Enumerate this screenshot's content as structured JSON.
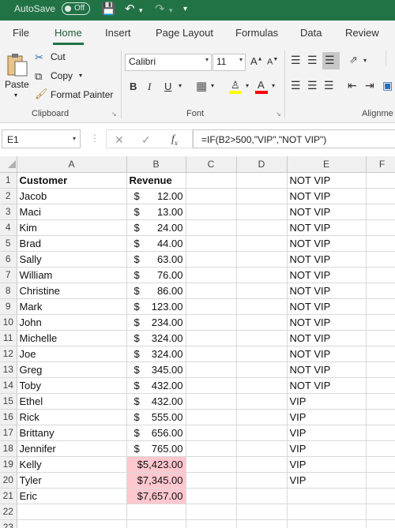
{
  "titlebar": {
    "autosave_label": "AutoSave",
    "autosave_state": "Off"
  },
  "ribbon_tabs": [
    "File",
    "Home",
    "Insert",
    "Page Layout",
    "Formulas",
    "Data",
    "Review"
  ],
  "active_tab": "Home",
  "clipboard": {
    "paste": "Paste",
    "cut": "Cut",
    "copy": "Copy",
    "format_painter": "Format Painter",
    "label": "Clipboard"
  },
  "font": {
    "name": "Calibri",
    "size": "11",
    "label": "Font",
    "bold": "B",
    "italic": "I",
    "underline": "U",
    "fill_color": "#ffff00",
    "text_color": "#ff0000"
  },
  "alignment": {
    "label": "Alignme"
  },
  "formula_bar": {
    "name_box": "E1",
    "formula": "=IF(B2>500,\"VIP\",\"NOT VIP\")"
  },
  "columns": [
    "A",
    "B",
    "C",
    "D",
    "E",
    "F"
  ],
  "active_column": "E",
  "headers": {
    "a": "Customer",
    "b": "Revenue"
  },
  "rows": [
    {
      "n": "1",
      "a": "Customer",
      "b": "Revenue",
      "e": "NOT VIP"
    },
    {
      "n": "2",
      "a": "Jacob",
      "b": "12.00",
      "e": "NOT VIP"
    },
    {
      "n": "3",
      "a": "Maci",
      "b": "13.00",
      "e": "NOT VIP"
    },
    {
      "n": "4",
      "a": "Kim",
      "b": "24.00",
      "e": "NOT VIP"
    },
    {
      "n": "5",
      "a": "Brad",
      "b": "44.00",
      "e": "NOT VIP"
    },
    {
      "n": "6",
      "a": "Sally",
      "b": "63.00",
      "e": "NOT VIP"
    },
    {
      "n": "7",
      "a": "William",
      "b": "76.00",
      "e": "NOT VIP"
    },
    {
      "n": "8",
      "a": "Christine",
      "b": "86.00",
      "e": "NOT VIP"
    },
    {
      "n": "9",
      "a": "Mark",
      "b": "123.00",
      "e": "NOT VIP"
    },
    {
      "n": "10",
      "a": "John",
      "b": "234.00",
      "e": "NOT VIP"
    },
    {
      "n": "11",
      "a": "Michelle",
      "b": "324.00",
      "e": "NOT VIP"
    },
    {
      "n": "12",
      "a": "Joe",
      "b": "324.00",
      "e": "NOT VIP"
    },
    {
      "n": "13",
      "a": "Greg",
      "b": "345.00",
      "e": "NOT VIP"
    },
    {
      "n": "14",
      "a": "Toby",
      "b": "432.00",
      "e": "NOT VIP"
    },
    {
      "n": "15",
      "a": "Ethel",
      "b": "432.00",
      "e": "VIP"
    },
    {
      "n": "16",
      "a": "Rick",
      "b": "555.00",
      "e": "VIP"
    },
    {
      "n": "17",
      "a": "Brittany",
      "b": "656.00",
      "e": "VIP"
    },
    {
      "n": "18",
      "a": "Jennifer",
      "b": "765.00",
      "e": "VIP"
    },
    {
      "n": "19",
      "a": "Kelly",
      "b": "$5,423.00",
      "e": "VIP",
      "hl": true
    },
    {
      "n": "20",
      "a": "Tyler",
      "b": "$7,345.00",
      "e": "VIP",
      "hl": true
    },
    {
      "n": "21",
      "a": "Eric",
      "b": "$7,657.00",
      "e": "",
      "hl": true
    },
    {
      "n": "22",
      "a": "",
      "b": "",
      "e": ""
    },
    {
      "n": "23",
      "a": "",
      "b": "",
      "e": ""
    }
  ],
  "currency_symbol": "$",
  "highlight_fill": "#ffc7ce",
  "highlight_text": "#9c0006",
  "accent": "#217346"
}
